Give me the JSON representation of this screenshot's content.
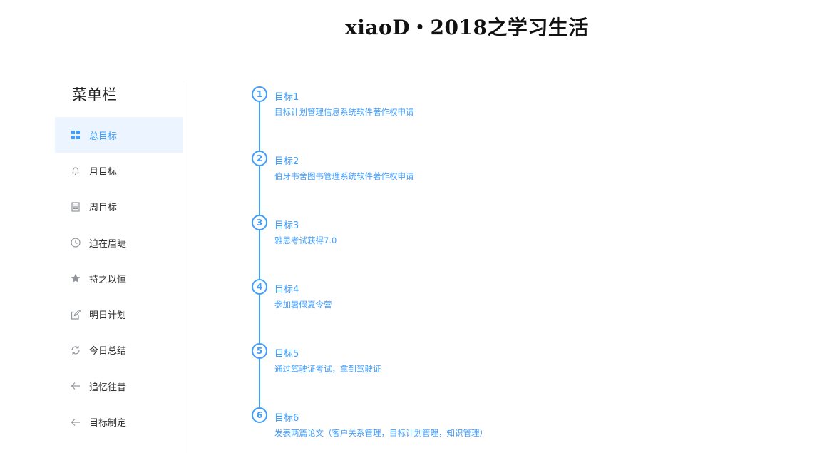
{
  "header": {
    "title": "xiaoD・2018之学习生活"
  },
  "sidebar": {
    "title": "菜单栏",
    "items": [
      {
        "label": "总目标",
        "icon": "grid-icon",
        "active": true
      },
      {
        "label": "月目标",
        "icon": "bell-icon"
      },
      {
        "label": "周目标",
        "icon": "document-icon"
      },
      {
        "label": "迫在眉睫",
        "icon": "clock-icon"
      },
      {
        "label": "持之以恒",
        "icon": "star-icon"
      },
      {
        "label": "明日计划",
        "icon": "edit-icon"
      },
      {
        "label": "今日总结",
        "icon": "refresh-icon"
      },
      {
        "label": "追忆往昔",
        "icon": "arrow-left-icon"
      },
      {
        "label": "目标制定",
        "icon": "arrow-left-icon"
      }
    ]
  },
  "timeline": {
    "accent_color": "#409eff",
    "items": [
      {
        "number": "1",
        "title": "目标1",
        "desc": "目标计划管理信息系统软件著作权申请"
      },
      {
        "number": "2",
        "title": "目标2",
        "desc": "伯牙书舍图书管理系统软件著作权申请"
      },
      {
        "number": "3",
        "title": "目标3",
        "desc": "雅思考试获得7.0"
      },
      {
        "number": "4",
        "title": "目标4",
        "desc": "参加暑假夏令营"
      },
      {
        "number": "5",
        "title": "目标5",
        "desc": "通过驾驶证考试，拿到驾驶证"
      },
      {
        "number": "6",
        "title": "目标6",
        "desc": "发表两篇论文（客户关系管理，目标计划管理，知识管理）"
      }
    ]
  }
}
